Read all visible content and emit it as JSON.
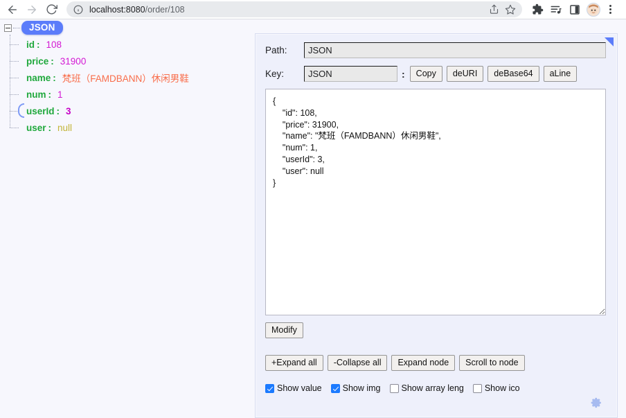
{
  "browser": {
    "back_icon": "arrow-left-icon",
    "forward_icon": "arrow-right-icon",
    "reload_icon": "reload-icon",
    "site_info_icon": "info-circle-icon",
    "url_host": "localhost:8080",
    "url_path": "/order/108",
    "url_full": "localhost:8080/order/108",
    "share_icon": "share-icon",
    "bookmark_icon": "star-icon",
    "extensions_icon": "puzzle-piece-icon",
    "reading_list_icon": "reading-list-icon",
    "side_panel_icon": "side-panel-icon",
    "profile_icon": "avatar-icon",
    "menu_icon": "three-dots-menu-icon"
  },
  "tree": {
    "root_label": "JSON",
    "collapse_toggle": "-",
    "nodes": [
      {
        "key": "id",
        "value": "108",
        "type": "number"
      },
      {
        "key": "price",
        "value": "31900",
        "type": "number"
      },
      {
        "key": "name",
        "value": "梵班（FAMDBANN）休闲男鞋",
        "type": "string"
      },
      {
        "key": "num",
        "value": "1",
        "type": "number"
      },
      {
        "key": "userId",
        "value": "3",
        "type": "number-selected"
      },
      {
        "key": "user",
        "value": "null",
        "type": "null"
      }
    ]
  },
  "panel": {
    "collapse_triangle_icon": "collapse-triangle-icon",
    "path_label": "Path:",
    "path_value": "JSON",
    "key_label": "Key:",
    "key_value": "JSON",
    "key_colon": ":",
    "buttons_inline": [
      {
        "label": "Copy"
      },
      {
        "label": "deURI"
      },
      {
        "label": "deBase64"
      },
      {
        "label": "aLine"
      }
    ],
    "json_text": "{\n    \"id\": 108,\n    \"price\": 31900,\n    \"name\": \"梵班（FAMDBANN）休闲男鞋\",\n    \"num\": 1,\n    \"userId\": 3,\n    \"user\": null\n}",
    "modify_label": "Modify",
    "node_buttons": [
      {
        "label": "+Expand all"
      },
      {
        "label": "-Collapse all"
      },
      {
        "label": "Expand node"
      },
      {
        "label": "Scroll to node"
      }
    ],
    "checkboxes": [
      {
        "label": "Show value",
        "checked": true
      },
      {
        "label": "Show img",
        "checked": true
      },
      {
        "label": "Show array leng",
        "checked": false
      },
      {
        "label": "Show ico",
        "checked": false
      }
    ],
    "settings_icon": "gear-icon"
  },
  "colors": {
    "accent_blue": "#5b7cfa",
    "panel_bg": "#eef0fb",
    "page_bg": "#f7f7fd",
    "key_green": "#1fa83c",
    "number_magenta": "#d318d3",
    "string_orange": "#f96d4a",
    "null_olive": "#c2b437",
    "checkbox_blue": "#1b7aff"
  }
}
